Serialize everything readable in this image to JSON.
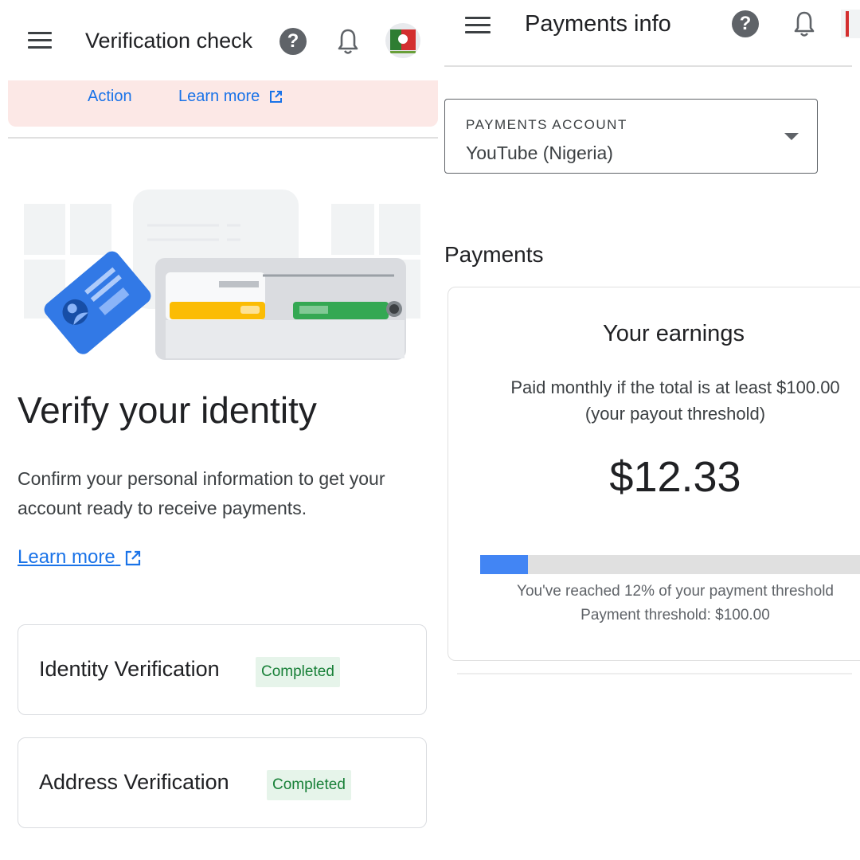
{
  "left": {
    "header": {
      "title": "Verification check"
    },
    "banner": {
      "action_label": "Action",
      "learn_more_label": "Learn more"
    },
    "hero": {
      "heading": "Verify your identity",
      "description": "Confirm your personal information to get your account ready to receive payments.",
      "learn_more_label": "Learn more"
    },
    "verifications": [
      {
        "label": "Identity Verification",
        "status": "Completed"
      },
      {
        "label": "Address Verification",
        "status": "Completed"
      }
    ]
  },
  "right": {
    "header": {
      "title": "Payments info"
    },
    "payments_account": {
      "label": "PAYMENTS ACCOUNT",
      "value": "YouTube (Nigeria)"
    },
    "section_title": "Payments",
    "earnings": {
      "title": "Your earnings",
      "subtitle": "Paid monthly if the total is at least $100.00\n(your payout threshold)",
      "amount": "$12.33",
      "progress_fraction": 0.12,
      "progress_text": "You've reached 12% of your payment threshold",
      "threshold_text": "Payment threshold: $100.00"
    }
  },
  "colors": {
    "accent": "#1a73e8",
    "banner_bg": "#fce8e6",
    "badge_bg": "#e6f4ea",
    "badge_text": "#188038",
    "progress_fill": "#4285f4"
  },
  "icons": [
    "menu-icon",
    "help-icon",
    "notification-bell-icon",
    "external-link-icon",
    "dropdown-arrow-icon",
    "avatar"
  ]
}
